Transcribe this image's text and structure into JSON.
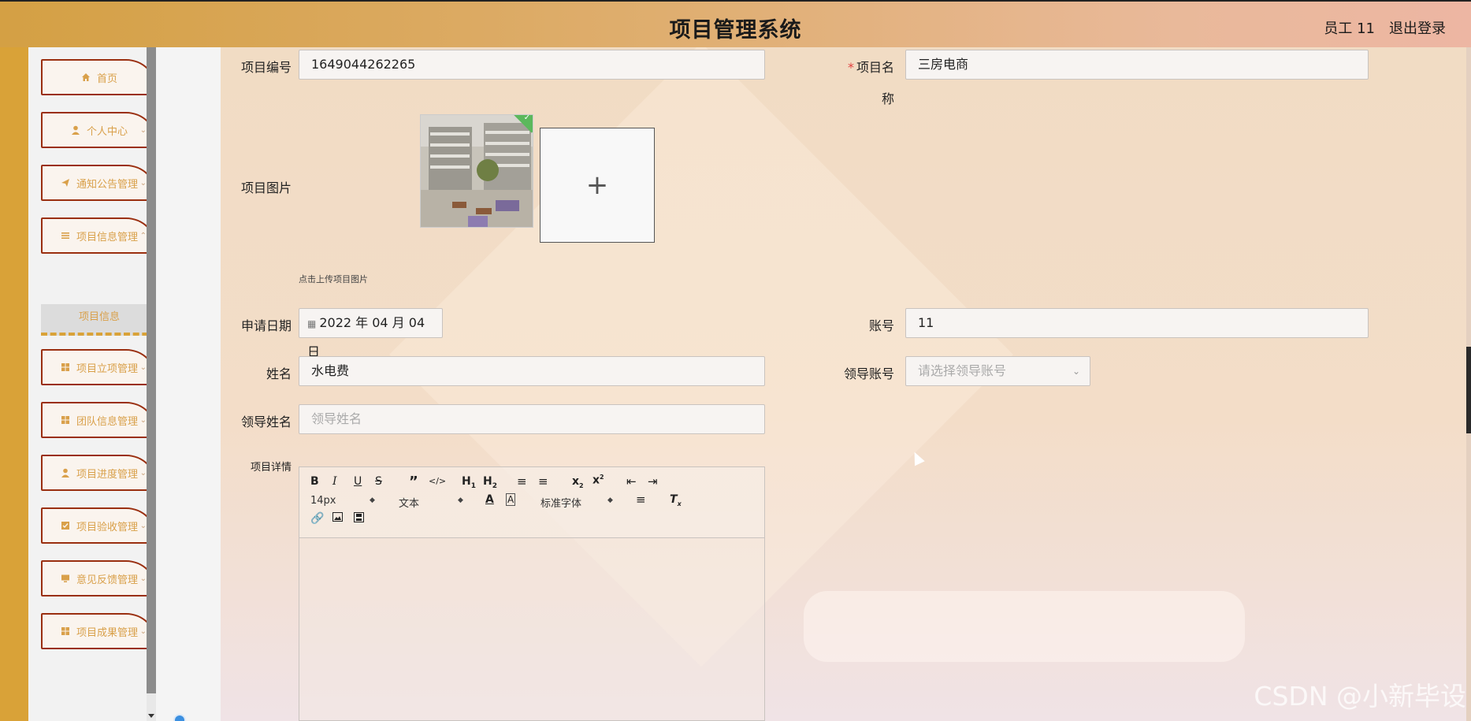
{
  "header": {
    "title": "项目管理系统",
    "user": "员工 11",
    "logout": "退出登录"
  },
  "sidebar": {
    "items": [
      {
        "label": "首页",
        "icon": "home-icon"
      },
      {
        "label": "个人中心",
        "icon": "user-icon"
      },
      {
        "label": "通知公告管理",
        "icon": "send-icon"
      },
      {
        "label": "项目信息管理",
        "icon": "list-icon"
      },
      {
        "label": "项目立项管理",
        "icon": "grid-icon"
      },
      {
        "label": "团队信息管理",
        "icon": "grid-icon"
      },
      {
        "label": "项目进度管理",
        "icon": "user-icon"
      },
      {
        "label": "项目验收管理",
        "icon": "checkbox-icon"
      },
      {
        "label": "意见反馈管理",
        "icon": "monitor-icon"
      },
      {
        "label": "项目成果管理",
        "icon": "grid-icon"
      }
    ],
    "sub_item": "项目信息"
  },
  "form": {
    "project_no_label": "项目编号",
    "project_no_value": "1649044262265",
    "project_name_label_a": "项目名",
    "project_name_label_b": "称",
    "project_name_value": "三房电商",
    "image_label": "项目图片",
    "upload_hint": "点击上传项目图片",
    "apply_date_label": "申请日期",
    "apply_date_value": "2022 年 04 月 04 日",
    "account_label": "账号",
    "account_value": "11",
    "name_label": "姓名",
    "name_value": "水电费",
    "leader_account_label": "领导账号",
    "leader_account_placeholder": "请选择领导账号",
    "leader_name_label": "领导姓名",
    "leader_name_placeholder": "领导姓名",
    "detail_label": "项目详情"
  },
  "editor": {
    "font_size": "14px",
    "paragraph": "文本",
    "font_family": "标准字体"
  },
  "watermark": "CSDN @小新毕设",
  "colors": {
    "accent": "#d9a238",
    "menu_border": "#9a2f10",
    "menu_text": "#d9a04a"
  }
}
